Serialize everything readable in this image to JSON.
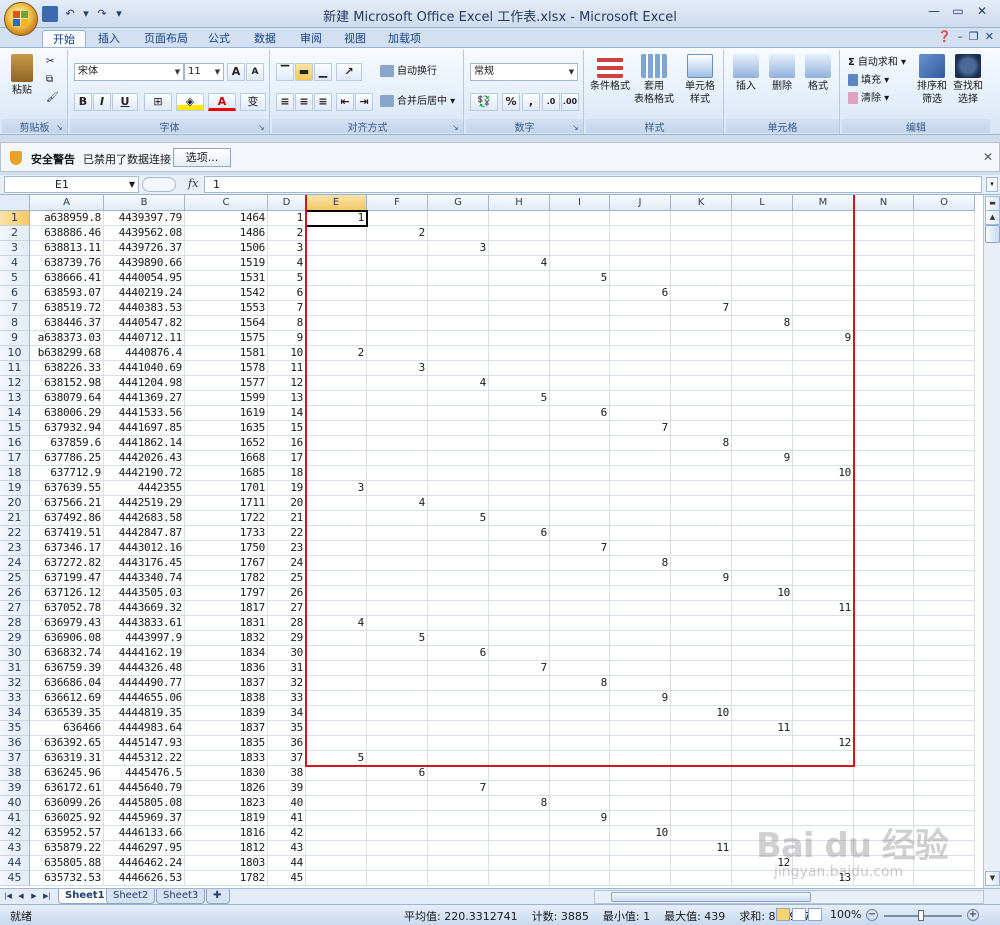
{
  "window": {
    "title": "新建 Microsoft Office Excel 工作表.xlsx - Microsoft Excel"
  },
  "ribbon_tabs": [
    "开始",
    "插入",
    "页面布局",
    "公式",
    "数据",
    "审阅",
    "视图",
    "加载项"
  ],
  "ribbon": {
    "clipboard": {
      "label": "剪贴板",
      "paste": "粘贴"
    },
    "font": {
      "label": "字体",
      "name": "宋体",
      "size": "11"
    },
    "alignment": {
      "label": "对齐方式",
      "wrap": "自动换行",
      "merge": "合并后居中"
    },
    "number": {
      "label": "数字",
      "format": "常规",
      "percent": "%",
      "comma": ","
    },
    "styles": {
      "label": "样式",
      "conditional": "条件格式",
      "table_a": "套用",
      "table_b": "表格格式",
      "cell_a": "单元格",
      "cell_b": "样式"
    },
    "cells": {
      "label": "单元格",
      "insert": "插入",
      "delete": "删除",
      "format": "格式"
    },
    "editing": {
      "label": "编辑",
      "autosum": "自动求和",
      "fill": "填充",
      "clear": "清除",
      "sort_a": "排序和",
      "sort_b": "筛选",
      "find_a": "查找和",
      "find_b": "选择"
    }
  },
  "security": {
    "title": "安全警告",
    "message": "已禁用了数据连接",
    "options_button": "选项..."
  },
  "formula_bar": {
    "name_box": "E1",
    "fx": "fx",
    "value": "1"
  },
  "columns": [
    "A",
    "B",
    "C",
    "D",
    "E",
    "F",
    "G",
    "H",
    "I",
    "J",
    "K",
    "L",
    "M",
    "N",
    "O"
  ],
  "rows": [
    {
      "n": "1",
      "a": "a638959.8",
      "b": "4439397.79",
      "c": "1464",
      "d": "1",
      "v": "1"
    },
    {
      "n": "2",
      "a": "638886.46",
      "b": "4439562.08",
      "c": "1486",
      "d": "2",
      "v": "2"
    },
    {
      "n": "3",
      "a": "638813.11",
      "b": "4439726.37",
      "c": "1506",
      "d": "3",
      "v": "3"
    },
    {
      "n": "4",
      "a": "638739.76",
      "b": "4439890.66",
      "c": "1519",
      "d": "4",
      "v": "4"
    },
    {
      "n": "5",
      "a": "638666.41",
      "b": "4440054.95",
      "c": "1531",
      "d": "5",
      "v": "5"
    },
    {
      "n": "6",
      "a": "638593.07",
      "b": "4440219.24",
      "c": "1542",
      "d": "6",
      "v": "6"
    },
    {
      "n": "7",
      "a": "638519.72",
      "b": "4440383.53",
      "c": "1553",
      "d": "7",
      "v": "7"
    },
    {
      "n": "8",
      "a": "638446.37",
      "b": "4440547.82",
      "c": "1564",
      "d": "8",
      "v": "8"
    },
    {
      "n": "9",
      "a": "a638373.03",
      "b": "4440712.11",
      "c": "1575",
      "d": "9",
      "v": "9"
    },
    {
      "n": "10",
      "a": "b638299.68",
      "b": "4440876.4",
      "c": "1581",
      "d": "10",
      "v": "2"
    },
    {
      "n": "11",
      "a": "638226.33",
      "b": "4441040.69",
      "c": "1578",
      "d": "11",
      "v": "3"
    },
    {
      "n": "12",
      "a": "638152.98",
      "b": "4441204.98",
      "c": "1577",
      "d": "12",
      "v": "4"
    },
    {
      "n": "13",
      "a": "638079.64",
      "b": "4441369.27",
      "c": "1599",
      "d": "13",
      "v": "5"
    },
    {
      "n": "14",
      "a": "638006.29",
      "b": "4441533.56",
      "c": "1619",
      "d": "14",
      "v": "6"
    },
    {
      "n": "15",
      "a": "637932.94",
      "b": "4441697.85",
      "c": "1635",
      "d": "15",
      "v": "7"
    },
    {
      "n": "16",
      "a": "637859.6",
      "b": "4441862.14",
      "c": "1652",
      "d": "16",
      "v": "8"
    },
    {
      "n": "17",
      "a": "637786.25",
      "b": "4442026.43",
      "c": "1668",
      "d": "17",
      "v": "9"
    },
    {
      "n": "18",
      "a": "637712.9",
      "b": "4442190.72",
      "c": "1685",
      "d": "18",
      "v": "10"
    },
    {
      "n": "19",
      "a": "637639.55",
      "b": "4442355",
      "c": "1701",
      "d": "19",
      "v": "3"
    },
    {
      "n": "20",
      "a": "637566.21",
      "b": "4442519.29",
      "c": "1711",
      "d": "20",
      "v": "4"
    },
    {
      "n": "21",
      "a": "637492.86",
      "b": "4442683.58",
      "c": "1722",
      "d": "21",
      "v": "5"
    },
    {
      "n": "22",
      "a": "637419.51",
      "b": "4442847.87",
      "c": "1733",
      "d": "22",
      "v": "6"
    },
    {
      "n": "23",
      "a": "637346.17",
      "b": "4443012.16",
      "c": "1750",
      "d": "23",
      "v": "7"
    },
    {
      "n": "24",
      "a": "637272.82",
      "b": "4443176.45",
      "c": "1767",
      "d": "24",
      "v": "8"
    },
    {
      "n": "25",
      "a": "637199.47",
      "b": "4443340.74",
      "c": "1782",
      "d": "25",
      "v": "9"
    },
    {
      "n": "26",
      "a": "637126.12",
      "b": "4443505.03",
      "c": "1797",
      "d": "26",
      "v": "10"
    },
    {
      "n": "27",
      "a": "637052.78",
      "b": "4443669.32",
      "c": "1817",
      "d": "27",
      "v": "11"
    },
    {
      "n": "28",
      "a": "636979.43",
      "b": "4443833.61",
      "c": "1831",
      "d": "28",
      "v": "4"
    },
    {
      "n": "29",
      "a": "636906.08",
      "b": "4443997.9",
      "c": "1832",
      "d": "29",
      "v": "5"
    },
    {
      "n": "30",
      "a": "636832.74",
      "b": "4444162.19",
      "c": "1834",
      "d": "30",
      "v": "6"
    },
    {
      "n": "31",
      "a": "636759.39",
      "b": "4444326.48",
      "c": "1836",
      "d": "31",
      "v": "7"
    },
    {
      "n": "32",
      "a": "636686.04",
      "b": "4444490.77",
      "c": "1837",
      "d": "32",
      "v": "8"
    },
    {
      "n": "33",
      "a": "636612.69",
      "b": "4444655.06",
      "c": "1838",
      "d": "33",
      "v": "9"
    },
    {
      "n": "34",
      "a": "636539.35",
      "b": "4444819.35",
      "c": "1839",
      "d": "34",
      "v": "10"
    },
    {
      "n": "35",
      "a": "636466",
      "b": "4444983.64",
      "c": "1837",
      "d": "35",
      "v": "11"
    },
    {
      "n": "36",
      "a": "636392.65",
      "b": "4445147.93",
      "c": "1835",
      "d": "36",
      "v": "12"
    },
    {
      "n": "37",
      "a": "636319.31",
      "b": "4445312.22",
      "c": "1833",
      "d": "37",
      "v": "5"
    },
    {
      "n": "38",
      "a": "636245.96",
      "b": "4445476.5",
      "c": "1830",
      "d": "38",
      "v": "6"
    },
    {
      "n": "39",
      "a": "636172.61",
      "b": "4445640.79",
      "c": "1826",
      "d": "39",
      "v": "7"
    },
    {
      "n": "40",
      "a": "636099.26",
      "b": "4445805.08",
      "c": "1823",
      "d": "40",
      "v": "8"
    },
    {
      "n": "41",
      "a": "636025.92",
      "b": "4445969.37",
      "c": "1819",
      "d": "41",
      "v": "9"
    },
    {
      "n": "42",
      "a": "635952.57",
      "b": "4446133.66",
      "c": "1816",
      "d": "42",
      "v": "10"
    },
    {
      "n": "43",
      "a": "635879.22",
      "b": "4446297.95",
      "c": "1812",
      "d": "43",
      "v": "11"
    },
    {
      "n": "44",
      "a": "635805.88",
      "b": "4446462.24",
      "c": "1803",
      "d": "44",
      "v": "12"
    },
    {
      "n": "45",
      "a": "635732.53",
      "b": "4446626.53",
      "c": "1782",
      "d": "45",
      "v": "13"
    }
  ],
  "sheet_tabs": [
    "Sheet1",
    "Sheet2",
    "Sheet3"
  ],
  "status": {
    "ready": "就绪",
    "average": "平均值: 220.3312741",
    "count": "计数: 3885",
    "min": "最小值: 1",
    "max": "最大值: 439",
    "sum": "求和: 855987",
    "zoom": "100%"
  },
  "watermark": {
    "logo": "Bai du 经验",
    "url": "jingyan.baidu.com"
  },
  "colors": {
    "selection_box": "#d4141e",
    "ribbon_text": "#15428b"
  }
}
